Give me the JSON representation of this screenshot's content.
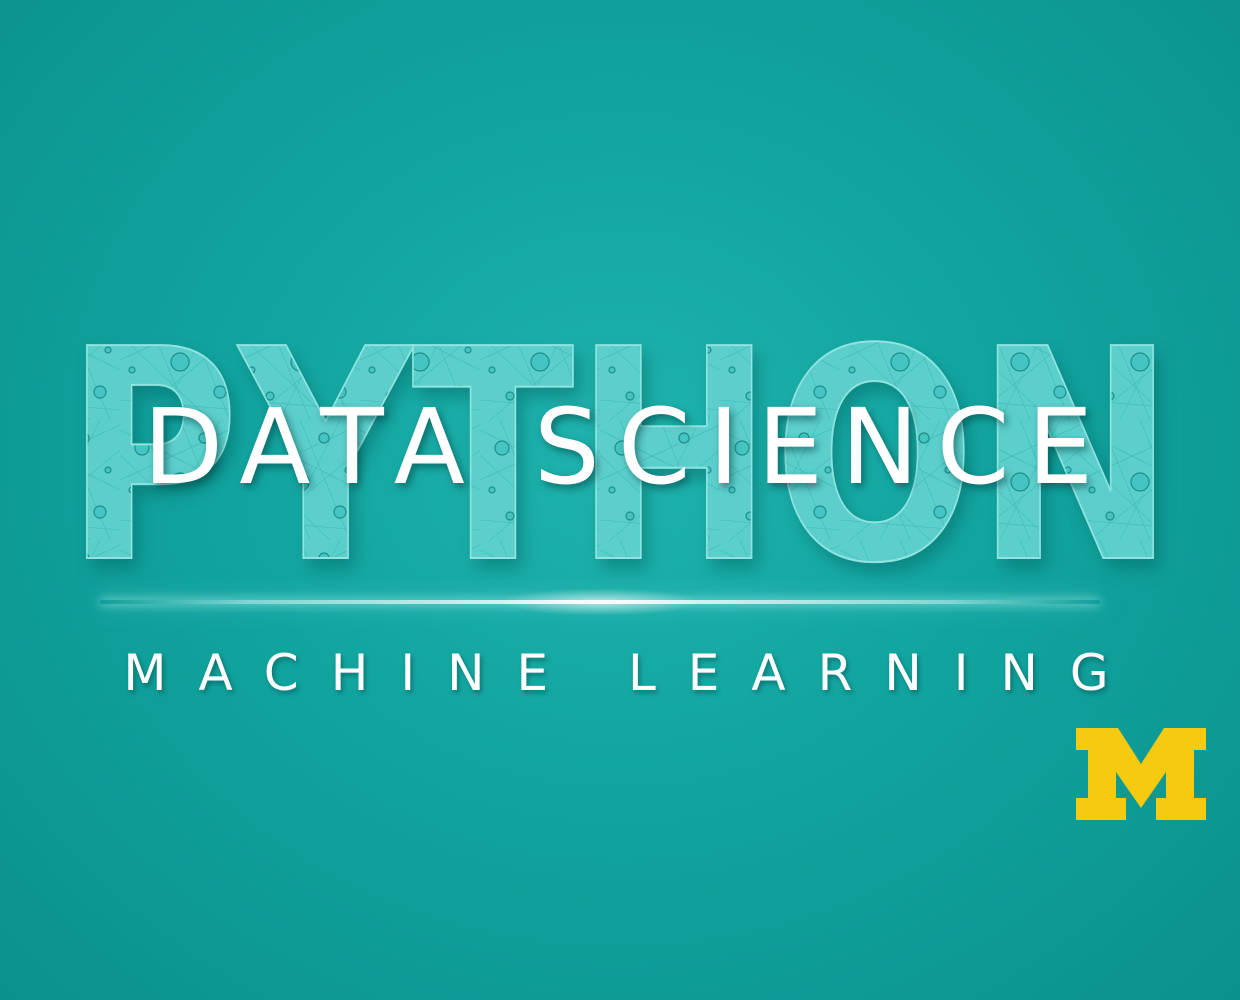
{
  "title": {
    "large_word": "PYTHON",
    "overlay_text": "DATA SCIENCE"
  },
  "tagline": "MACHINE LEARNING",
  "logo": {
    "letter": "M",
    "icon": "block-m-logo-icon",
    "color": "#F5CA0F"
  },
  "colors": {
    "background": "#11A49F",
    "letter_fill": "#5FD3D0",
    "node_fill": "#3BC2BF",
    "text": "#FFFFFF"
  }
}
